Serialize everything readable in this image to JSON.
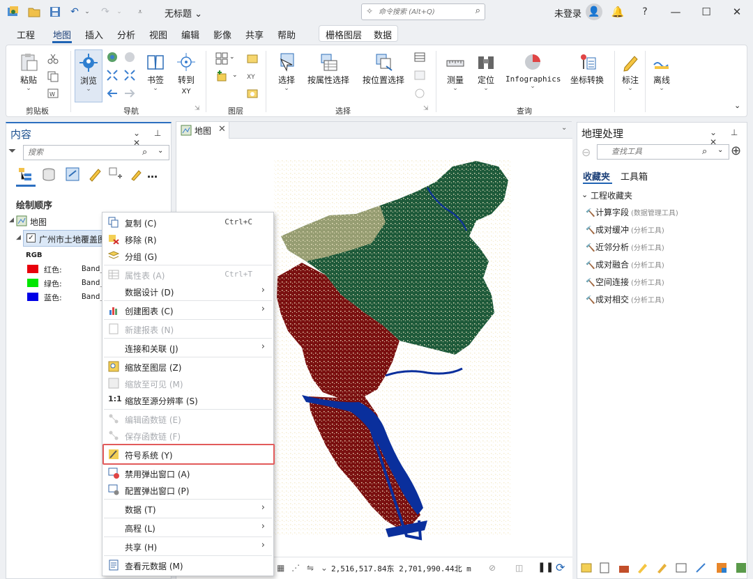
{
  "titlebar": {
    "doc_title": "无标题",
    "search_placeholder": "命令搜索 (Alt+Q)",
    "login": "未登录"
  },
  "ribbon_tabs": [
    "工程",
    "地图",
    "插入",
    "分析",
    "视图",
    "编辑",
    "影像",
    "共享",
    "帮助"
  ],
  "active_tab": "地图",
  "context_tabs": [
    "栅格图层",
    "数据"
  ],
  "ribbon": {
    "clipboard": {
      "paste": "粘贴",
      "group": "剪贴板"
    },
    "navigate": {
      "explore": "浏览",
      "bookmarks": "书签",
      "goto": "转到",
      "goto2": "XY",
      "group": "导航"
    },
    "layer": {
      "group": "图层"
    },
    "selection": {
      "select": "选择",
      "by_attr": "按属性选择",
      "by_loc": "按位置选择",
      "group": "选择"
    },
    "inquiry": {
      "measure": "测量",
      "locate": "定位",
      "infographics": "Infographics",
      "coord": "坐标转换",
      "group": "查询"
    },
    "labeling": {
      "label": "标注"
    },
    "offline": {
      "offline": "离线"
    }
  },
  "contents": {
    "title": "内容",
    "search_placeholder": "搜索",
    "section": "绘制顺序",
    "map_node": "地图",
    "layer_name": "广州市土地覆盖图",
    "rgb": "RGB",
    "bands": [
      {
        "label": "红色:",
        "value": "Band_",
        "color": "#e8000b"
      },
      {
        "label": "绿色:",
        "value": "Band_",
        "color": "#00e600"
      },
      {
        "label": "蓝色:",
        "value": "Band_",
        "color": "#0000e6"
      }
    ]
  },
  "map": {
    "tab": "地图",
    "coords": "2,516,517.84东 2,701,990.44北 m",
    "colors": {
      "forest": "#1e5a3a",
      "urban": "#7a1010",
      "water": "#0a2f9c",
      "sand": "#f3e9c8"
    }
  },
  "context_menu": [
    {
      "label": "复制 (C)",
      "shortcut": "Ctrl+C",
      "icon": "copy-icon",
      "disabled": false
    },
    {
      "label": "移除 (R)",
      "icon": "remove-icon",
      "disabled": false
    },
    {
      "label": "分组 (G)",
      "icon": "group-icon",
      "disabled": false
    },
    {
      "label": "属性表 (A)",
      "shortcut": "Ctrl+T",
      "icon": "table-icon",
      "disabled": true
    },
    {
      "label": "数据设计 (D)",
      "arrow": true,
      "disabled": false
    },
    {
      "label": "创建图表 (C)",
      "arrow": true,
      "icon": "chart-icon",
      "disabled": false
    },
    {
      "label": "新建报表 (N)",
      "icon": "report-icon",
      "disabled": true
    },
    {
      "label": "连接和关联 (J)",
      "arrow": true,
      "disabled": false
    },
    {
      "label": "缩放至图层 (Z)",
      "icon": "zoom-layer-icon",
      "disabled": false
    },
    {
      "label": "缩放至可见 (M)",
      "icon": "zoom-visible-icon",
      "disabled": true
    },
    {
      "label": "缩放至源分辨率 (S)",
      "icon": "one-to-one-icon",
      "disabled": false
    },
    {
      "label": "编辑函数链 (E)",
      "icon": "function-chain-icon",
      "disabled": true
    },
    {
      "label": "保存函数链 (F)",
      "icon": "save-chain-icon",
      "disabled": true
    },
    {
      "label": "符号系统 (Y)",
      "icon": "symbology-icon",
      "disabled": false
    },
    {
      "label": "禁用弹出窗口 (A)",
      "icon": "disable-popup-icon",
      "disabled": false
    },
    {
      "label": "配置弹出窗口 (P)",
      "icon": "configure-popup-icon",
      "disabled": false
    },
    {
      "label": "数据 (T)",
      "arrow": true,
      "disabled": false
    },
    {
      "label": "高程 (L)",
      "arrow": true,
      "disabled": false
    },
    {
      "label": "共享 (H)",
      "arrow": true,
      "disabled": false
    },
    {
      "label": "查看元数据 (M)",
      "icon": "metadata-icon",
      "disabled": false
    }
  ],
  "geoprocessing": {
    "title": "地理处理",
    "search_placeholder": "查找工具",
    "tabs": [
      "收藏夹",
      "工具箱"
    ],
    "section": "工程收藏夹",
    "tools": [
      {
        "name": "计算字段",
        "box": "(数据管理工具)"
      },
      {
        "name": "成对缓冲",
        "box": "(分析工具)"
      },
      {
        "name": "近邻分析",
        "box": "(分析工具)"
      },
      {
        "name": "成对融合",
        "box": "(分析工具)"
      },
      {
        "name": "空间连接",
        "box": "(分析工具)"
      },
      {
        "name": "成对相交",
        "box": "(分析工具)"
      }
    ]
  }
}
